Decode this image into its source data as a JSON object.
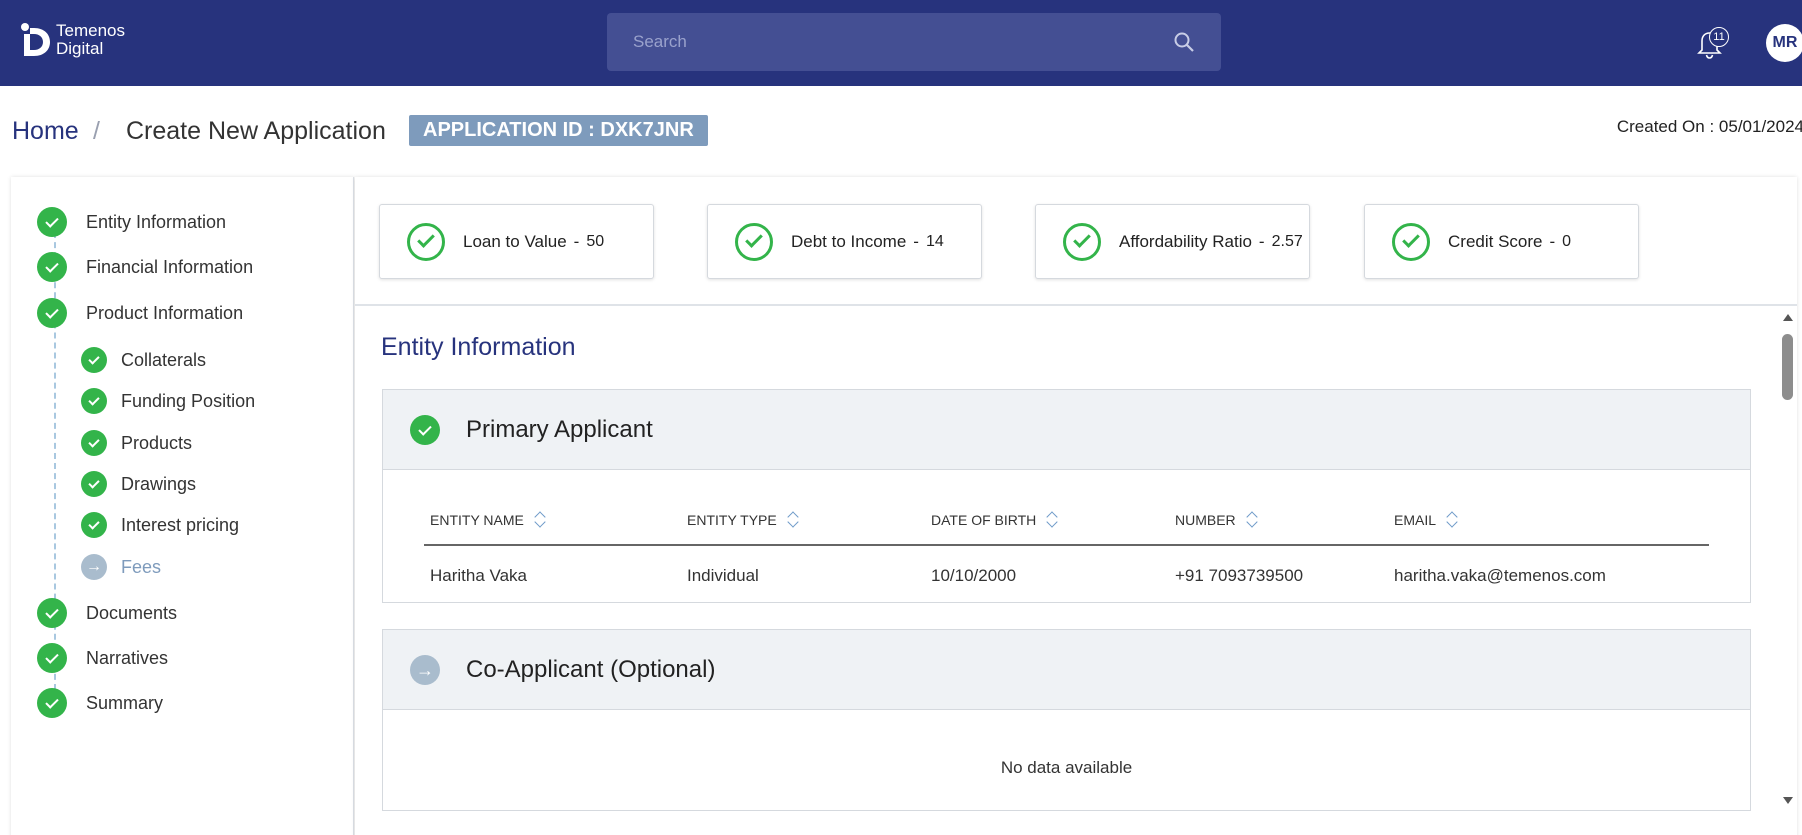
{
  "header": {
    "logo_line1": "Temenos",
    "logo_line2": "Digital",
    "search_placeholder": "Search",
    "notification_count": "11",
    "avatar_initials": "MR",
    "brand_color": "#27337d"
  },
  "breadcrumb": {
    "home": "Home",
    "separator": "/",
    "current": "Create New Application"
  },
  "application_id": "APPLICATION ID : DXK7JNR",
  "created_on": "Created On : 05/01/2024",
  "steps": [
    {
      "label": "Entity Information",
      "status": "complete"
    },
    {
      "label": "Financial Information",
      "status": "complete"
    },
    {
      "label": "Product Information",
      "status": "complete"
    },
    {
      "label": "Collaterals",
      "status": "complete"
    },
    {
      "label": "Funding Position",
      "status": "complete"
    },
    {
      "label": "Products",
      "status": "complete"
    },
    {
      "label": "Drawings",
      "status": "complete"
    },
    {
      "label": "Interest pricing",
      "status": "complete"
    },
    {
      "label": "Fees",
      "status": "pending"
    },
    {
      "label": "Documents",
      "status": "complete"
    },
    {
      "label": "Narratives",
      "status": "complete"
    },
    {
      "label": "Summary",
      "status": "complete"
    }
  ],
  "metrics": [
    {
      "label": "Loan to Value",
      "separator": "-",
      "value": "50"
    },
    {
      "label": "Debt to Income",
      "separator": "-",
      "value": "14"
    },
    {
      "label": "Affordability Ratio",
      "separator": "-",
      "value": "2.57"
    },
    {
      "label": "Credit Score",
      "separator": "-",
      "value": "0"
    }
  ],
  "section_title": "Entity Information",
  "primary_applicant": {
    "title": "Primary Applicant",
    "columns": [
      "ENTITY NAME",
      "ENTITY TYPE",
      "DATE OF BIRTH",
      "NUMBER",
      "EMAIL"
    ],
    "row": [
      "Haritha Vaka",
      "Individual",
      "10/10/2000",
      "+91 7093739500",
      "haritha.vaka@temenos.com"
    ]
  },
  "co_applicant": {
    "title": "Co-Applicant (Optional)",
    "empty_text": "No data available"
  },
  "colors": {
    "success": "#33b44a",
    "pending": "#a9bccd",
    "badge": "#7e9bbc"
  }
}
